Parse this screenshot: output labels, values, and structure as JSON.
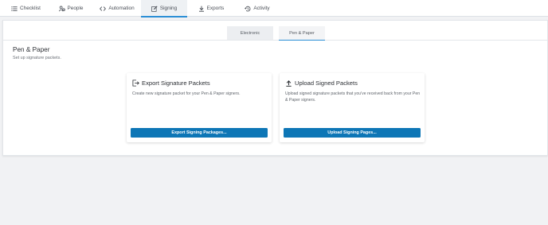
{
  "nav": {
    "tabs": [
      {
        "label": "Checklist",
        "icon": "list-icon"
      },
      {
        "label": "People",
        "icon": "people-icon"
      },
      {
        "label": "Automation",
        "icon": "code-icon"
      },
      {
        "label": "Signing",
        "icon": "edit-signature-icon",
        "active": true
      },
      {
        "label": "Exports",
        "icon": "download-icon"
      },
      {
        "label": "Activity",
        "icon": "history-icon"
      }
    ]
  },
  "subtabs": [
    {
      "label": "Electronic",
      "active": false
    },
    {
      "label": "Pen & Paper",
      "active": true
    }
  ],
  "section": {
    "title": "Pen & Paper",
    "subtitle": "Set up signature packets."
  },
  "cards": {
    "export": {
      "title": "Export Signature Packets",
      "icon": "export-icon",
      "description": "Create new signature packet for your Pen & Paper signers.",
      "button": "Export Signing Packages..."
    },
    "upload": {
      "title": "Upload Signed Packets",
      "icon": "upload-icon",
      "description": "Upload signed signature packets that you've received back from your Pen & Paper signers.",
      "button": "Upload Signing Pages..."
    }
  },
  "colors": {
    "accent": "#2b8fd6",
    "button": "#0d76b6",
    "background": "#f1f2f4"
  }
}
